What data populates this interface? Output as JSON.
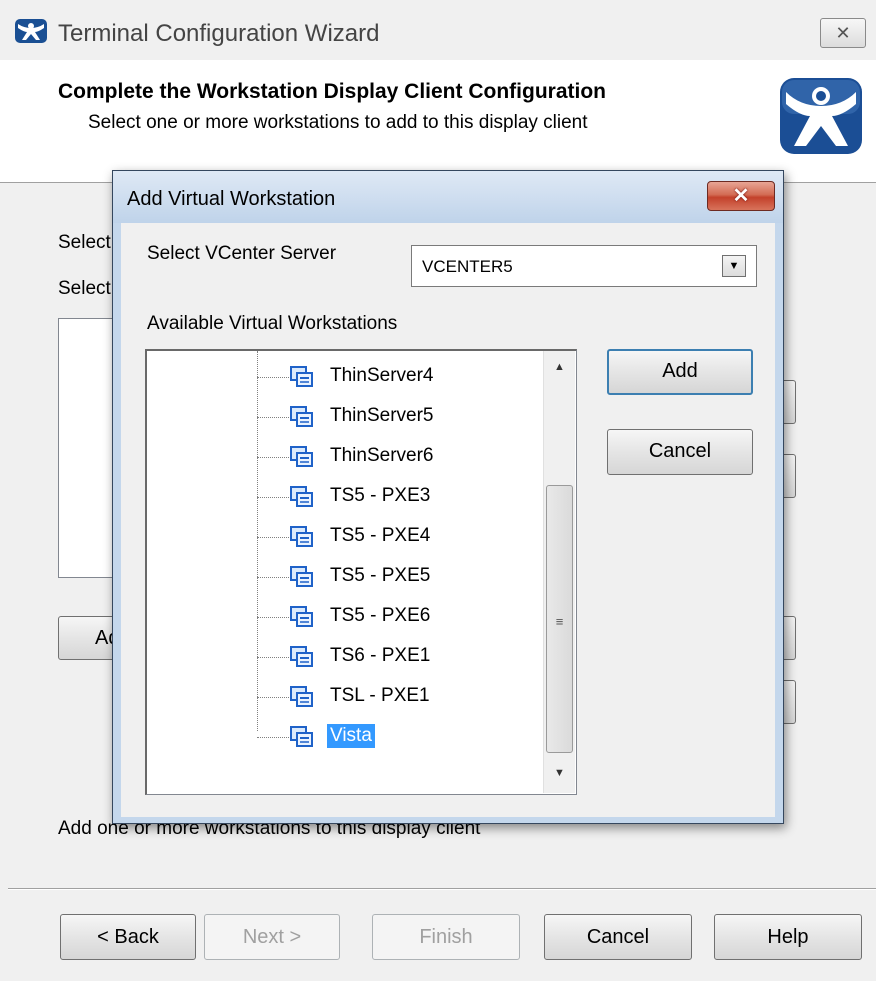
{
  "wizard": {
    "title": "Terminal Configuration Wizard",
    "close_glyph": "✕",
    "header_title": "Complete the Workstation Display Client Configuration",
    "header_subtitle": "Select one or more workstations to add to this display client",
    "label_select_1": "Select",
    "label_select_2": "Select",
    "add_button_partial": "Ad",
    "status_text": "Add one or more workstations to this display client",
    "buttons": {
      "back": "< Back",
      "next": "Next >",
      "finish": "Finish",
      "cancel": "Cancel",
      "help": "Help"
    },
    "logo_icon": "thinmanager-logo-icon"
  },
  "dialog": {
    "title": "Add Virtual Workstation",
    "close_glyph": "✕",
    "vcenter_label": "Select VCenter Server",
    "vcenter_value": "VCENTER5",
    "available_label": "Available Virtual Workstations",
    "add_button": "Add",
    "cancel_button": "Cancel",
    "workstations": [
      {
        "name": "ThinServer4",
        "selected": false
      },
      {
        "name": "ThinServer5",
        "selected": false
      },
      {
        "name": "ThinServer6",
        "selected": false
      },
      {
        "name": "TS5 - PXE3",
        "selected": false
      },
      {
        "name": "TS5 - PXE4",
        "selected": false
      },
      {
        "name": "TS5 - PXE5",
        "selected": false
      },
      {
        "name": "TS5 - PXE6",
        "selected": false
      },
      {
        "name": "TS6 - PXE1",
        "selected": false
      },
      {
        "name": "TSL - PXE1",
        "selected": false
      },
      {
        "name": "Vista",
        "selected": true
      }
    ],
    "workstation_icon": "virtual-machine-icon",
    "scrollbar": {
      "grip_glyph": "≡",
      "up_glyph": "▲",
      "down_glyph": "▼"
    },
    "dropdown_glyph": "▼"
  }
}
